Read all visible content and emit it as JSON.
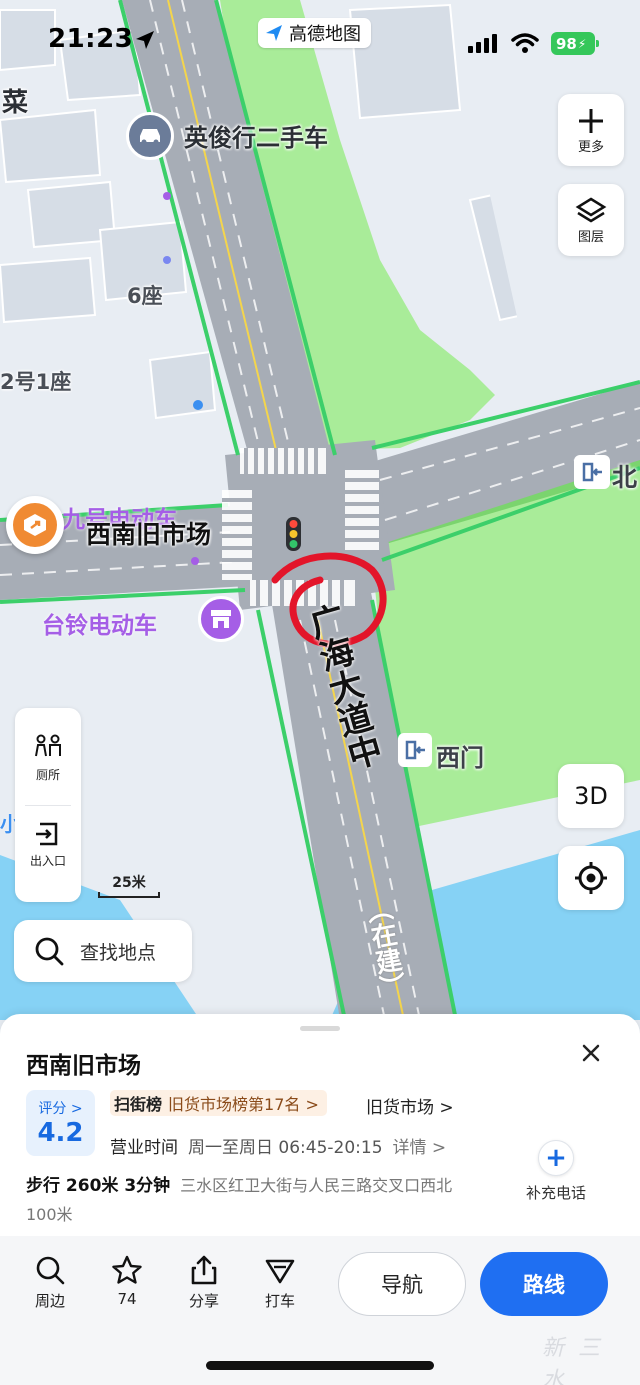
{
  "status": {
    "time": "21:23",
    "battery": "98",
    "app_badge": "高德地图"
  },
  "map": {
    "labels": {
      "car_shop": "英俊行二手车",
      "cai": "菜",
      "seat6": "6座",
      "seat_no": "2号1座",
      "ev_top": "九号电动车",
      "market": "西南旧市场",
      "tailing": "台铃电动车",
      "north": "北",
      "road_name": "广海大道中",
      "west_gate": "西门",
      "construction": "（在建）",
      "small_left": "小"
    },
    "scale": "25米",
    "right_buttons": {
      "more": "更多",
      "layers": "图层",
      "three_d": "3D"
    },
    "left_panel": {
      "toilet": "厕所",
      "entrance": "出入口"
    },
    "search_placeholder": "查找地点",
    "colors": {
      "road": "#a7adb6",
      "grass": "#a9ec99",
      "water": "#86d2f5",
      "green_edge": "#3ccf6a",
      "annotation": "#e3152a"
    }
  },
  "poi": {
    "name": "西南旧市场",
    "score_label": "评分 >",
    "score": "4.2",
    "rank_key": "扫街榜",
    "rank_value": "旧货市场榜第17名 >",
    "category": "旧货市场 >",
    "hours_label": "营业时间",
    "hours_time": "周一至周日 06:45-20:15",
    "hours_detail": "详情 >",
    "walk": "步行 260米 3分钟",
    "address": "三水区红卫大街与人民三路交叉口西北",
    "distance_extra": "100米",
    "add_phone": "补充电话"
  },
  "bottom": {
    "nearby": "周边",
    "favorites": "74",
    "share": "分享",
    "taxi": "打车",
    "navigate": "导航",
    "route": "路线"
  },
  "watermark": "新三水"
}
